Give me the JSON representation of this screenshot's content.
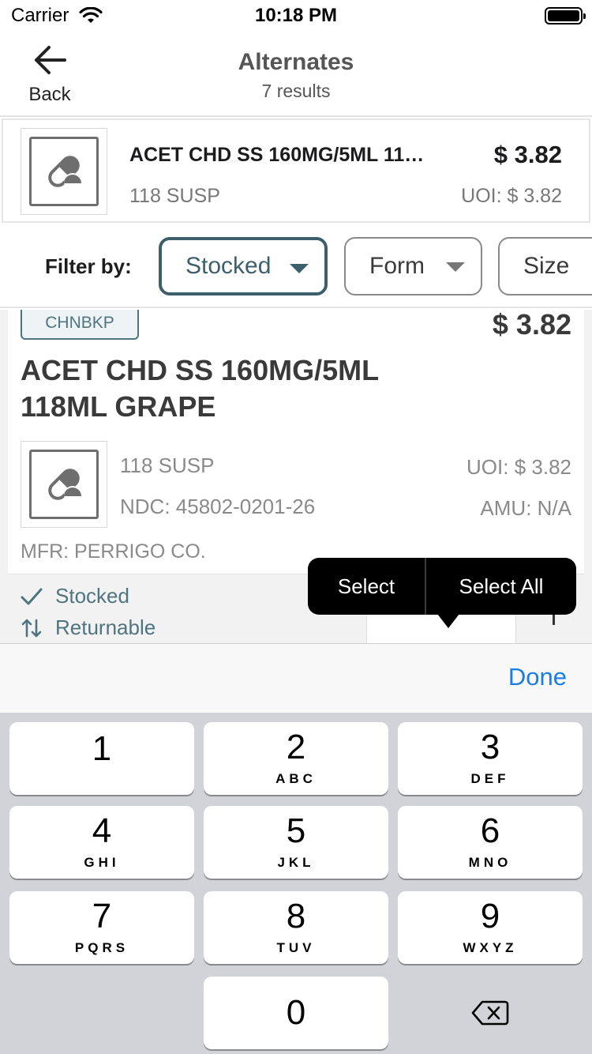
{
  "status_bar": {
    "carrier": "Carrier",
    "time": "10:18 PM"
  },
  "nav": {
    "back_label": "Back",
    "title": "Alternates",
    "subtitle": "7 results"
  },
  "selected_product": {
    "name": "ACET CHD SS 160MG/5ML 11…",
    "price": "$ 3.82",
    "size": "118 SUSP",
    "uoi": "UOI: $ 3.82"
  },
  "filter": {
    "label": "Filter by:",
    "chips": [
      {
        "label": "Stocked",
        "active": true
      },
      {
        "label": "Form",
        "active": false
      },
      {
        "label": "Size",
        "active": false
      }
    ]
  },
  "card": {
    "badge": "CHNBKP",
    "price": "$ 3.82",
    "title_line1": "ACET CHD SS 160MG/5ML",
    "title_line2": "118ML GRAPE",
    "size": "118 SUSP",
    "ndc": "NDC: 45802-0201-26",
    "uoi": "UOI: $ 3.82",
    "amu": "AMU: N/A",
    "mfr": "MFR: PERRIGO CO.",
    "stocked_label": "Stocked",
    "returnable_label": "Returnable"
  },
  "edit_menu": {
    "select": "Select",
    "select_all": "Select All"
  },
  "keyboard": {
    "done": "Done",
    "keys": [
      {
        "digit": "1",
        "letters": ""
      },
      {
        "digit": "2",
        "letters": "ABC"
      },
      {
        "digit": "3",
        "letters": "DEF"
      },
      {
        "digit": "4",
        "letters": "GHI"
      },
      {
        "digit": "5",
        "letters": "JKL"
      },
      {
        "digit": "6",
        "letters": "MNO"
      },
      {
        "digit": "7",
        "letters": "PQRS"
      },
      {
        "digit": "8",
        "letters": "TUV"
      },
      {
        "digit": "9",
        "letters": "WXYZ"
      },
      {
        "digit": "0",
        "letters": ""
      }
    ]
  },
  "colors": {
    "accent_teal": "#3d5f6b",
    "link_blue": "#1a7ee3",
    "keypad_bg": "#d1d3d9"
  },
  "icons": [
    "wifi-icon",
    "battery-icon",
    "back-arrow-icon",
    "pill-icon",
    "chevron-down-icon",
    "checkmark-icon",
    "swap-arrows-icon",
    "delete-backspace-icon"
  ]
}
